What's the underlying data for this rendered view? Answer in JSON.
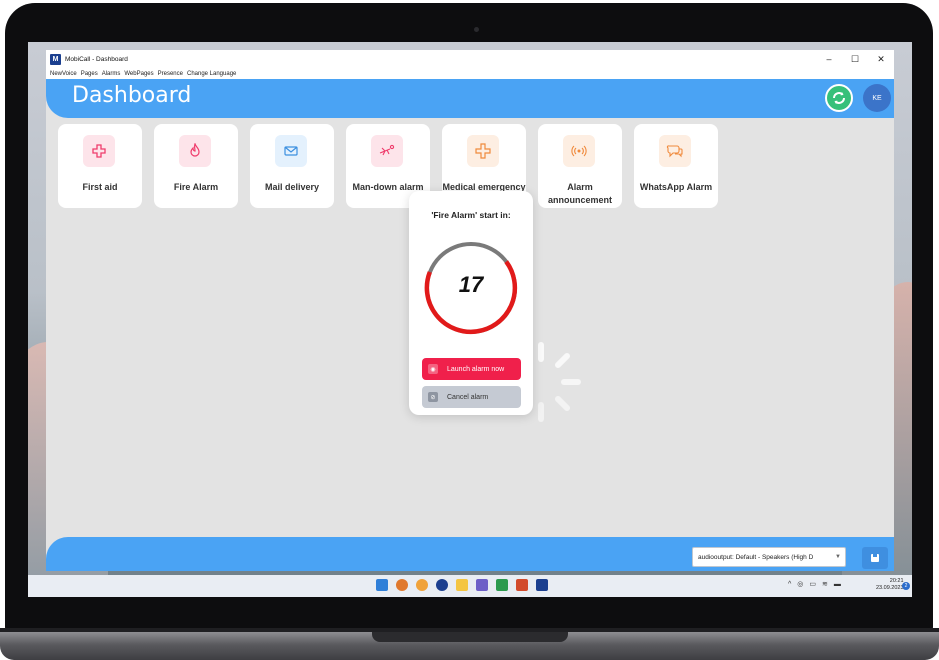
{
  "window": {
    "title": "MobiCall - Dashboard",
    "controls": {
      "minimize": "–",
      "maximize": "☐",
      "close": "✕"
    }
  },
  "menu": [
    "NewVoice",
    "Pages",
    "Alarms",
    "WebPages",
    "Presence",
    "Change Language"
  ],
  "header": {
    "title": "Dashboard",
    "avatar_initials": "KE"
  },
  "tiles": [
    {
      "label": "First aid",
      "icon": "medical-cross-icon",
      "bg": "#fde4ea",
      "fg": "#ef3b6b"
    },
    {
      "label": "Fire Alarm",
      "icon": "flame-icon",
      "bg": "#fde4ea",
      "fg": "#ef3b6b"
    },
    {
      "label": "Mail delivery",
      "icon": "mail-icon",
      "bg": "#e4f1fd",
      "fg": "#3b8fe0"
    },
    {
      "label": "Man-down alarm",
      "icon": "man-down-icon",
      "bg": "#fde4ea",
      "fg": "#ef3b6b"
    },
    {
      "label": "Medical emergency",
      "icon": "bandage-icon",
      "bg": "#fdeee2",
      "fg": "#f08a3c"
    },
    {
      "label": "Alarm announcement",
      "icon": "broadcast-icon",
      "bg": "#fdeee2",
      "fg": "#f08a3c"
    },
    {
      "label": "WhatsApp Alarm",
      "icon": "chat-icon",
      "bg": "#fdeee2",
      "fg": "#f08a3c"
    }
  ],
  "modal": {
    "title": "'Fire Alarm' start in:",
    "countdown": "17",
    "launch_label": "Launch alarm now",
    "cancel_label": "Cancel alarm"
  },
  "footer": {
    "audio_output": "audiooutput: Default - Speakers (High D"
  },
  "taskbar": {
    "time": "20:21",
    "date": "23.09.2023",
    "notifications": "2"
  },
  "colors": {
    "accent": "#4aa3f4",
    "danger": "#f0204b",
    "success": "#36c07a"
  }
}
